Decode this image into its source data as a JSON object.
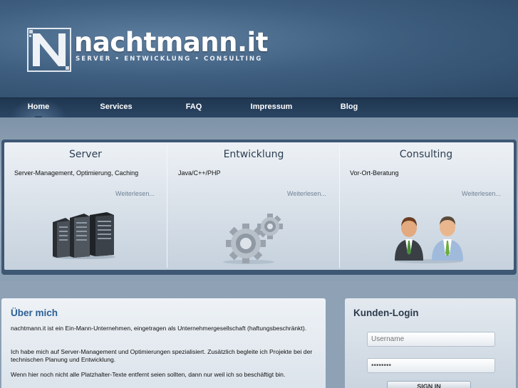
{
  "header": {
    "title": "nachtmann.it",
    "tagline": "SERVER • ENTWICKLUNG • CONSULTING"
  },
  "nav": {
    "items": [
      {
        "label": "Home",
        "active": true
      },
      {
        "label": "Services",
        "active": false
      },
      {
        "label": "FAQ",
        "active": false
      },
      {
        "label": "Impressum",
        "active": false
      },
      {
        "label": "Blog",
        "active": false
      }
    ]
  },
  "features": [
    {
      "title": "Server",
      "text": "Server-Management, Optimierung, Caching",
      "more": "Weiterlesen...",
      "icon": "server-rack-icon"
    },
    {
      "title": "Entwicklung",
      "text": "Java/C++/PHP",
      "more": "Weiterlesen...",
      "icon": "gears-icon"
    },
    {
      "title": "Consulting",
      "text": "Vor-Ort-Beratung",
      "more": "Weiterlesen...",
      "icon": "business-people-icon"
    }
  ],
  "about": {
    "title": "Über mich",
    "paragraphs": [
      "nachtmann.it ist ein Ein-Mann-Unternehmen, eingetragen als Unternehmergesellschaft (haftungsbeschränkt).",
      "Ich habe mich auf Server-Management und Optimierungen spezialisiert. Zusätzlich begleite ich Projekte bei der technischen Planung und Entwicklung.",
      "Wenn hier noch nicht alle Platzhalter-Texte entfernt seien sollten, dann nur weil ich so beschäftigt bin."
    ]
  },
  "login": {
    "title": "Kunden-Login",
    "username_placeholder": "Username",
    "password_value": "••••••••",
    "button_label": "SIGN IN"
  },
  "colors": {
    "header_bg": "#3f5f80",
    "nav_bg": "#1f3650",
    "accent_title": "#2b5f96"
  }
}
